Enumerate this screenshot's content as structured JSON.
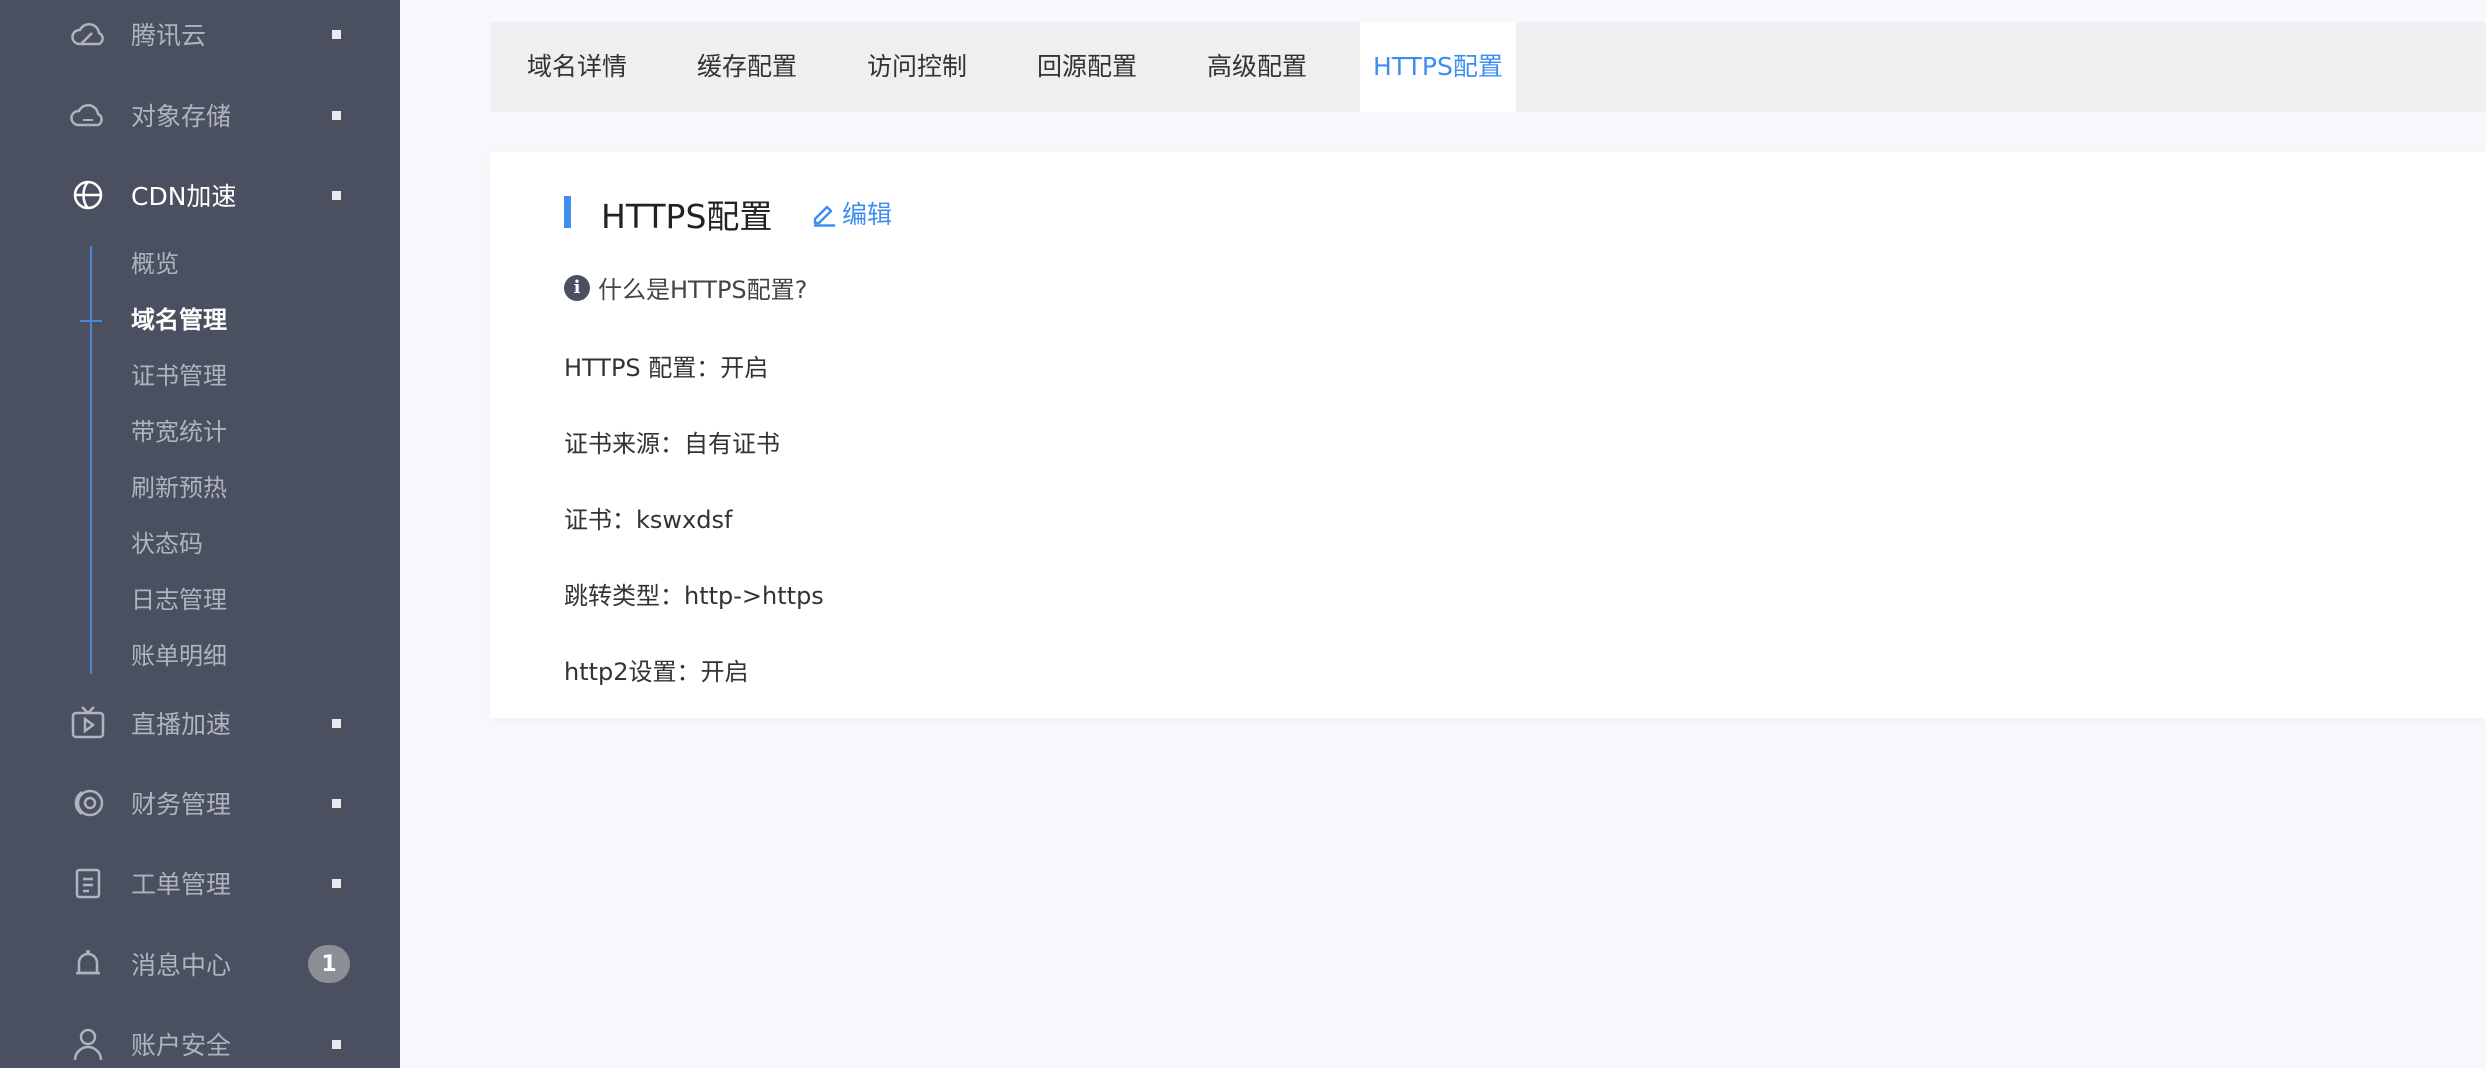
{
  "sidebar": {
    "items": [
      {
        "label": "腾讯云",
        "icon": "cloud-icon"
      },
      {
        "label": "对象存储",
        "icon": "cloud-storage-icon"
      },
      {
        "label": "CDN加速",
        "icon": "cdn-globe-icon"
      },
      {
        "label": "直播加速",
        "icon": "tv-play-icon"
      },
      {
        "label": "财务管理",
        "icon": "finance-coin-icon"
      },
      {
        "label": "工单管理",
        "icon": "ticket-doc-icon"
      },
      {
        "label": "消息中心",
        "icon": "bell-icon",
        "badge": "1"
      },
      {
        "label": "账户安全",
        "icon": "user-icon"
      }
    ],
    "cdn_submenu": [
      "概览",
      "域名管理",
      "证书管理",
      "带宽统计",
      "刷新预热",
      "状态码",
      "日志管理",
      "账单明细"
    ],
    "active_item": "CDN加速",
    "active_subitem": "域名管理"
  },
  "tabs": [
    "域名详情",
    "缓存配置",
    "访问控制",
    "回源配置",
    "高级配置",
    "HTTPS配置"
  ],
  "active_tab": "HTTPS配置",
  "card": {
    "title": "HTTPS配置",
    "edit_label": "编辑",
    "help_text": "什么是HTTPS配置?",
    "fields": [
      "HTTPS 配置：开启",
      "证书来源：自有证书",
      "证书：kswxdsf",
      "跳转类型：http->https",
      "http2设置：开启"
    ]
  },
  "colors": {
    "sidebar_bg": "#4a5060",
    "accent": "#3d8ef0",
    "tab_bar_bg": "#efeff1",
    "page_bg": "#f7f8fb"
  }
}
